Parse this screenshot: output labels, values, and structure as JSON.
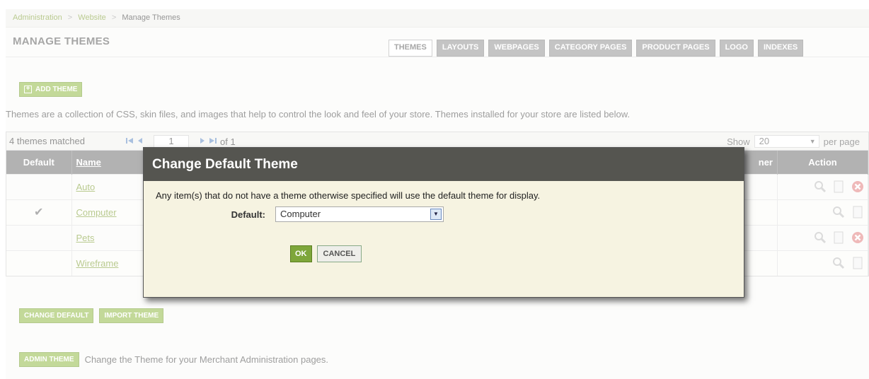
{
  "breadcrumb": {
    "items": [
      "Administration",
      "Website"
    ],
    "current": "Manage Themes",
    "separator": ">"
  },
  "header": {
    "title": "MANAGE THEMES"
  },
  "tabs": [
    {
      "label": "THEMES",
      "active": true
    },
    {
      "label": "LAYOUTS"
    },
    {
      "label": "WEBPAGES"
    },
    {
      "label": "CATEGORY PAGES"
    },
    {
      "label": "PRODUCT PAGES"
    },
    {
      "label": "LOGO"
    },
    {
      "label": "INDEXES"
    }
  ],
  "toolbar": {
    "add_theme_label": "ADD THEME",
    "plus_glyph": "+"
  },
  "description": "Themes are a collection of CSS, skin files, and images that help to control the look and feel of your store. Themes installed for your store are listed below.",
  "list": {
    "matched_text": "4 themes matched",
    "page_current": "1",
    "page_total_text": "of 1",
    "show_label": "Show",
    "show_value": "20",
    "per_page_label": "per page",
    "columns": {
      "default": "Default",
      "name": "Name",
      "action": "Action",
      "partial_header": "ner"
    },
    "rows": [
      {
        "default_mark": "",
        "name": "Auto"
      },
      {
        "default_mark": "✔",
        "name": "Computer"
      },
      {
        "default_mark": "",
        "name": "Pets"
      },
      {
        "default_mark": "",
        "name": "Wireframe"
      }
    ]
  },
  "bottom_buttons": {
    "change_default": "CHANGE DEFAULT",
    "import_theme": "IMPORT THEME"
  },
  "admin": {
    "button_label": "ADMIN THEME",
    "text": "Change the Theme for your Merchant Administration pages."
  },
  "modal": {
    "title": "Change Default Theme",
    "message": "Any item(s) that do not have a theme otherwise specified will use the default theme for display.",
    "default_label": "Default:",
    "default_value": "Computer",
    "ok_label": "OK",
    "cancel_label": "CANCEL"
  },
  "colors": {
    "accent_green": "#8cb63c",
    "modal_header": "#555550",
    "modal_body": "#f6f3e1",
    "link_green": "#7a9a2a"
  }
}
